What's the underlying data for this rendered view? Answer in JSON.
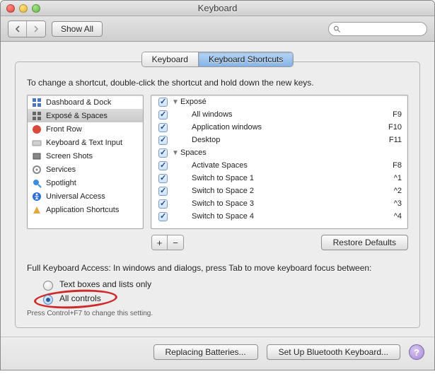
{
  "window": {
    "title": "Keyboard"
  },
  "toolbar": {
    "show_all": "Show All",
    "search_placeholder": ""
  },
  "tabs": {
    "keyboard": "Keyboard",
    "shortcuts": "Keyboard Shortcuts"
  },
  "instruction": "To change a shortcut, double-click the shortcut and hold down the new keys.",
  "categories": [
    {
      "label": "Dashboard & Dock",
      "icon": "dashboard-icon",
      "selected": false
    },
    {
      "label": "Exposé & Spaces",
      "icon": "expose-icon",
      "selected": true
    },
    {
      "label": "Front Row",
      "icon": "frontrow-icon",
      "selected": false
    },
    {
      "label": "Keyboard & Text Input",
      "icon": "keyboard-icon",
      "selected": false
    },
    {
      "label": "Screen Shots",
      "icon": "screenshot-icon",
      "selected": false
    },
    {
      "label": "Services",
      "icon": "services-icon",
      "selected": false
    },
    {
      "label": "Spotlight",
      "icon": "spotlight-icon",
      "selected": false
    },
    {
      "label": "Universal Access",
      "icon": "universal-icon",
      "selected": false
    },
    {
      "label": "Application Shortcuts",
      "icon": "appshortcuts-icon",
      "selected": false
    }
  ],
  "shortcuts": {
    "groups": [
      {
        "name": "Exposé",
        "items": [
          {
            "label": "All windows",
            "key": "F9"
          },
          {
            "label": "Application windows",
            "key": "F10"
          },
          {
            "label": "Desktop",
            "key": "F11"
          }
        ]
      },
      {
        "name": "Spaces",
        "items": [
          {
            "label": "Activate Spaces",
            "key": "F8"
          },
          {
            "label": "Switch to Space 1",
            "key": "^1"
          },
          {
            "label": "Switch to Space 2",
            "key": "^2"
          },
          {
            "label": "Switch to Space 3",
            "key": "^3"
          },
          {
            "label": "Switch to Space 4",
            "key": "^4"
          }
        ]
      }
    ]
  },
  "restore_defaults": "Restore Defaults",
  "fka": {
    "label": "Full Keyboard Access: In windows and dialogs, press Tab to move keyboard focus between:",
    "option_text": "Text boxes and lists only",
    "option_all": "All controls",
    "note": "Press Control+F7 to change this setting."
  },
  "bottom": {
    "replacing": "Replacing Batteries...",
    "bluetooth": "Set Up Bluetooth Keyboard...",
    "help": "?"
  },
  "colors": {
    "accent": "#86b3e6",
    "highlight_ring": "#cf2a2a"
  }
}
